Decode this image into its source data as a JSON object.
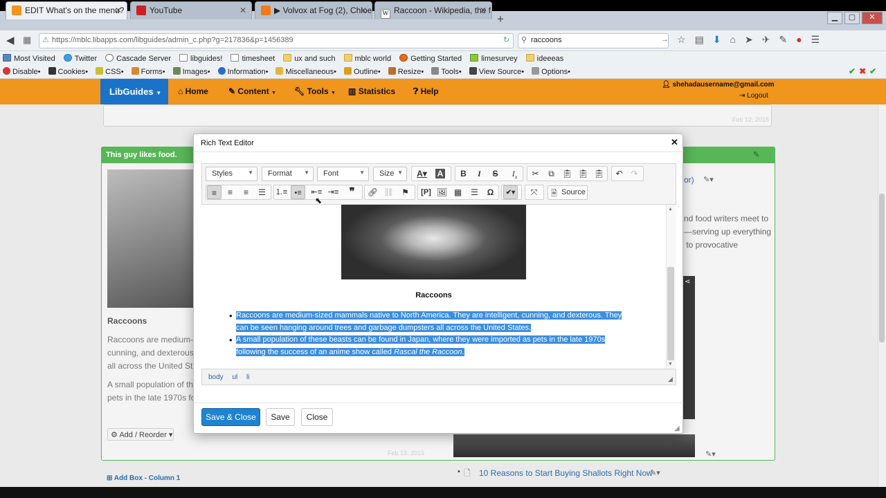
{
  "browser": {
    "tabs": [
      {
        "label": "EDIT What's on the menu? - A ...",
        "active": true
      },
      {
        "label": "YouTube",
        "active": false
      },
      {
        "label": "▶ Volvox at Fog (2), Chloe...",
        "active": false
      },
      {
        "label": "Raccoon - Wikipedia, the f...",
        "active": false
      }
    ],
    "url": "https://mblc.libapps.com/libguides/admin_c.php?g=217836&p=1456389",
    "search_value": "raccoons",
    "bookmarks": [
      "Most Visited",
      "Twitter",
      "Cascade Server",
      "libguides!",
      "timesheet",
      "ux and such",
      "mblc world",
      "Getting Started",
      "limesurvey",
      "ideeeas"
    ],
    "devtools": [
      "Disable•",
      "Cookies•",
      "CSS•",
      "Forms•",
      "Images•",
      "Information•",
      "Miscellaneous•",
      "Outline•",
      "Resize•",
      "Tools•",
      "View Source•",
      "Options•"
    ]
  },
  "libguides": {
    "brand": "LibGuides",
    "nav": [
      "Home",
      "Content",
      "Tools",
      "Statistics",
      "Help"
    ],
    "user": "shehadausername@gmail.com",
    "logout": "Logout"
  },
  "page": {
    "box_title": "This guy likes food.",
    "left_caption": "Raccoons",
    "left_text1": "Raccoons are medium-si\ncunning, and dexterous.\nall across the United Stat",
    "left_text2": "A small population of the\npets in the late 1970s fol",
    "add_reorder": "Add / Reorder",
    "add_box": "Add Box - Column 1",
    "right_text": "nd food writers meet to\n—serving up everything\n to provocative",
    "right_link_frag": "or)",
    "right_link": "10 Reasons to Start Buying Shallots Right Now",
    "date1": "Feb 12, 2015",
    "date2": "Feb 13, 2015"
  },
  "modal": {
    "title": "Rich Text Editor",
    "styles_label": "Styles",
    "format_label": "Format",
    "font_label": "Font",
    "size_label": "Size",
    "source_label": "Source",
    "caption": "Raccoons",
    "bullet1": "Raccoons are medium-sized mammals native to North America. They are intelligent, cunning, and dexterous. They can be seen hanging around trees and garbage dumpsters all across the United States.",
    "bullet2_a": "A small population of these beasts can be found in Japan, where they were imported as pets in the late 1970s following the success of an anime show called ",
    "bullet2_italic": "Rascal the Raccoon",
    "bullet2_end": ".",
    "path": "body ul li",
    "save_close": "Save & Close",
    "save": "Save",
    "close": "Close"
  }
}
